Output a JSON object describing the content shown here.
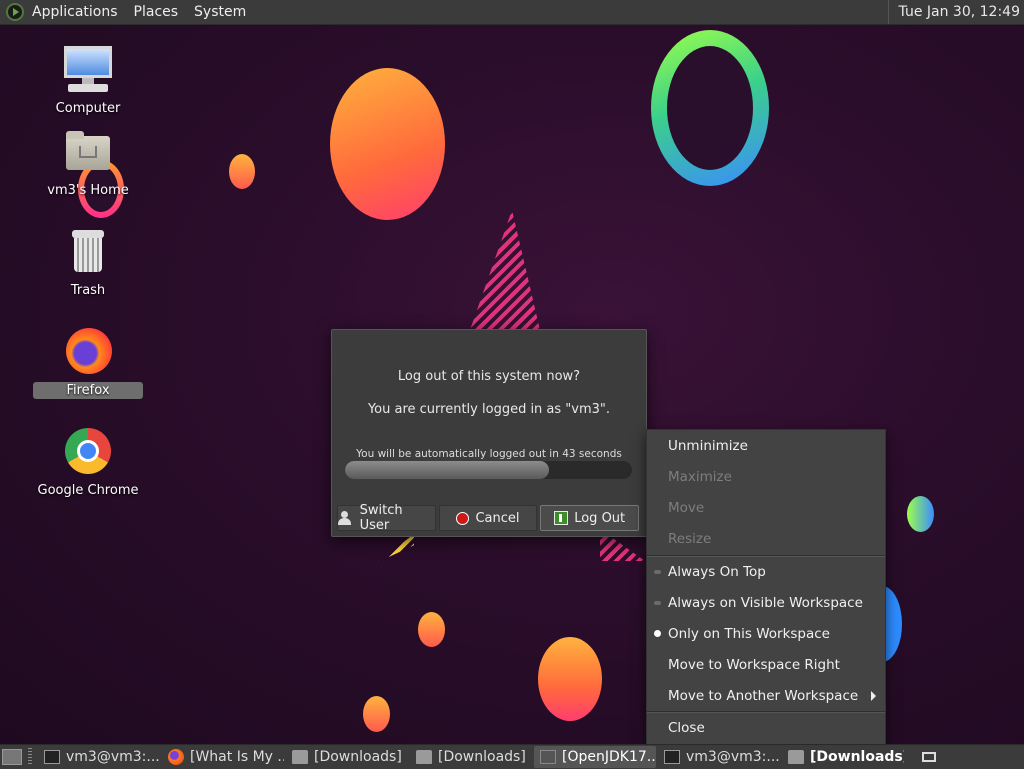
{
  "top_panel": {
    "menus": [
      "Applications",
      "Places",
      "System"
    ],
    "clock": "Tue Jan 30, 12:49"
  },
  "desktop": {
    "icons": [
      {
        "label": "Computer",
        "icon": "computer-icon"
      },
      {
        "label": "vm3's Home",
        "icon": "home-folder-icon"
      },
      {
        "label": "Trash",
        "icon": "trash-icon"
      },
      {
        "label": "Firefox",
        "icon": "firefox-icon"
      },
      {
        "label": "Google Chrome",
        "icon": "chrome-icon"
      }
    ]
  },
  "logout_dialog": {
    "question": "Log out of this system now?",
    "user_line": "You are currently logged in as \"vm3\".",
    "countdown": "You will be automatically logged out in 43 seconds",
    "progress_fraction": 0.71,
    "buttons": {
      "switch_user": "Switch User",
      "cancel": "Cancel",
      "log_out": "Log Out"
    }
  },
  "context_menu": {
    "items": [
      {
        "label": "Unminimize",
        "enabled": true
      },
      {
        "label": "Maximize",
        "enabled": false
      },
      {
        "label": "Move",
        "enabled": false
      },
      {
        "label": "Resize",
        "enabled": false
      },
      {
        "label": "Always On Top",
        "enabled": true,
        "radio": "off"
      },
      {
        "label": "Always on Visible Workspace",
        "enabled": true,
        "radio": "off"
      },
      {
        "label": "Only on This Workspace",
        "enabled": true,
        "radio": "on"
      },
      {
        "label": "Move to Workspace Right",
        "enabled": true
      },
      {
        "label": "Move to Another Workspace",
        "enabled": true,
        "submenu": true
      },
      {
        "label": "Close",
        "enabled": true
      }
    ]
  },
  "taskbar": {
    "tasks": [
      {
        "label": "vm3@vm3:...",
        "icon": "terminal-icon"
      },
      {
        "label": "[What Is My ...",
        "icon": "firefox-icon"
      },
      {
        "label": "[Downloads]",
        "icon": "folder-icon"
      },
      {
        "label": "[Downloads]",
        "icon": "folder-icon"
      },
      {
        "label": "[OpenJDK17...",
        "icon": "java-icon"
      },
      {
        "label": "vm3@vm3:...",
        "icon": "terminal-icon"
      },
      {
        "label": "[Downloads]",
        "icon": "folder-icon",
        "active": true
      }
    ]
  }
}
